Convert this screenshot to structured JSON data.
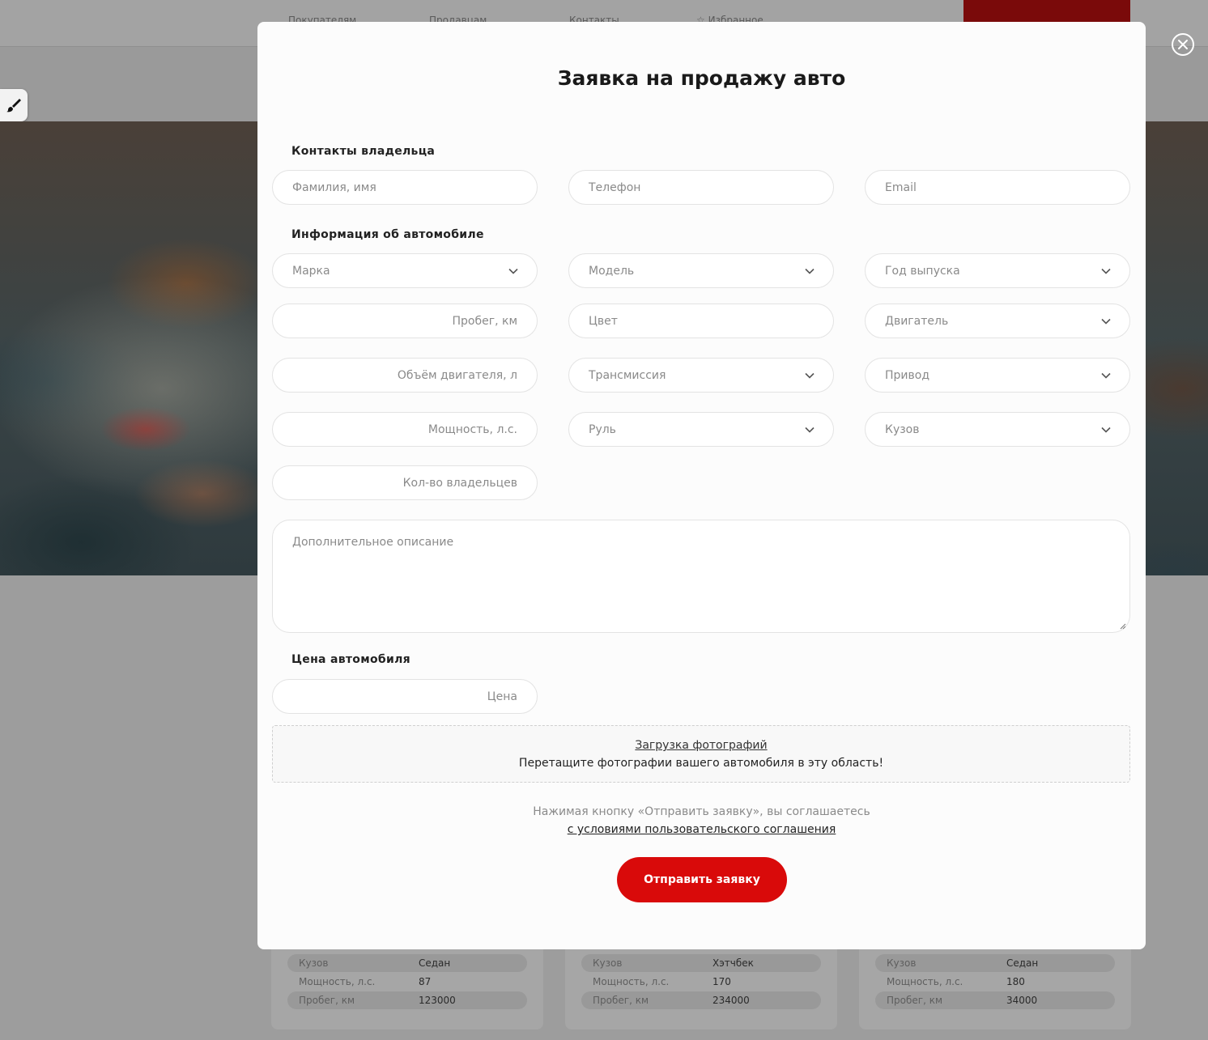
{
  "background": {
    "nav": [
      "Покупателям",
      "Продавцам",
      "Контакты",
      "Избранное"
    ],
    "cars": [
      {
        "specs": [
          {
            "label": "Кузов",
            "value": "Седан"
          },
          {
            "label": "Мощность, л.с.",
            "value": "87"
          },
          {
            "label": "Пробег, км",
            "value": "123000"
          }
        ]
      },
      {
        "specs": [
          {
            "label": "Кузов",
            "value": "Хэтчбек"
          },
          {
            "label": "Мощность, л.с.",
            "value": "170"
          },
          {
            "label": "Пробег, км",
            "value": "234000"
          }
        ]
      },
      {
        "specs": [
          {
            "label": "Кузов",
            "value": "Седан"
          },
          {
            "label": "Мощность, л.с.",
            "value": "180"
          },
          {
            "label": "Пробег, км",
            "value": "34000"
          }
        ]
      }
    ]
  },
  "modal": {
    "title": "Заявка на продажу авто",
    "contacts_label": "Контакты владельца",
    "contacts": {
      "name_placeholder": "Фамилия, имя",
      "phone_placeholder": "Телефон",
      "email_placeholder": "Email"
    },
    "car_info_label": "Информация об автомобиле",
    "car_fields": {
      "brand": "Марка",
      "model": "Модель",
      "year": "Год выпуска",
      "mileage": "Пробег, км",
      "color": "Цвет",
      "engine": "Двигатель",
      "engine_volume": "Объём двигателя, л",
      "transmission": "Трансмиссия",
      "drive": "Привод",
      "power": "Мощность, л.с.",
      "steering": "Руль",
      "body": "Кузов",
      "owners": "Кол-во владельцев"
    },
    "description_placeholder": "Дополнительное описание",
    "price_label": "Цена автомобиля",
    "price_placeholder": "Цена",
    "upload": {
      "link": "Загрузка фотографий",
      "hint": "Перетащите фотографии вашего автомобиля в эту область!"
    },
    "agreement": {
      "text": "Нажимая кнопку «Отправить заявку», вы соглашаетесь",
      "link": "с условиями пользовательского соглашения"
    },
    "submit_label": "Отправить заявку"
  },
  "colors": {
    "accent": "#d90a0a",
    "overlay": "#9a9a9a",
    "modal_bg": "#fcfcfc"
  }
}
